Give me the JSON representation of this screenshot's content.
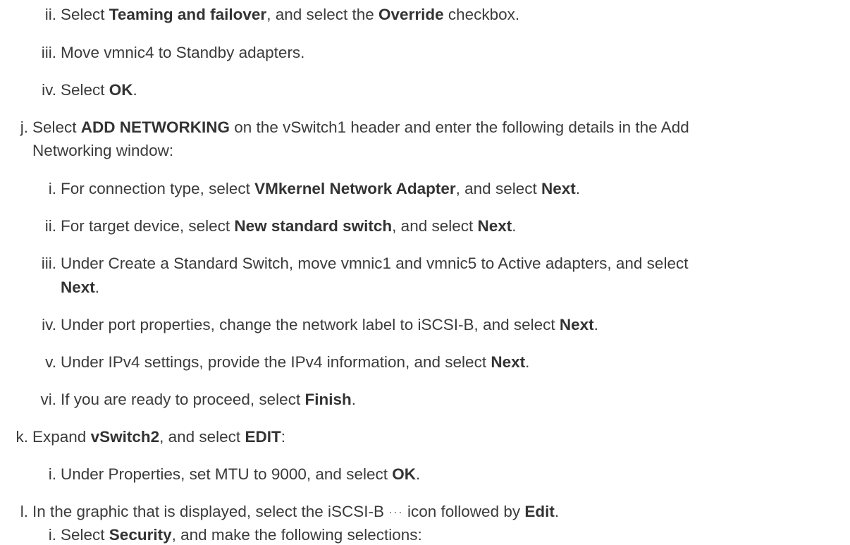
{
  "steps": {
    "ii1": {
      "label": "ii.",
      "a": "Select ",
      "b1": "Teaming and failover",
      "c": ", and select the ",
      "b2": "Override",
      "d": " checkbox."
    },
    "iii1": {
      "label": "iii.",
      "a": "Move vmnic4 to Standby adapters."
    },
    "iv1": {
      "label": "iv.",
      "a": "Select ",
      "b1": "OK",
      "c": "."
    },
    "j": {
      "label": "j.",
      "a": "Select ",
      "b1": "ADD NETWORKING",
      "c": " on the vSwitch1 header and enter the following details in the Add",
      "cont": "Networking window:"
    },
    "j_i": {
      "label": "i.",
      "a": "For connection type, select ",
      "b1": "VMkernel Network Adapter",
      "c": ", and select ",
      "b2": "Next",
      "d": "."
    },
    "j_ii": {
      "label": "ii.",
      "a": "For target device, select ",
      "b1": "New standard switch",
      "c": ", and select ",
      "b2": "Next",
      "d": "."
    },
    "j_iii": {
      "label": "iii.",
      "a": "Under Create a Standard Switch, move vmnic1 and vmnic5 to Active adapters, and select",
      "cont_b": "Next",
      "cont_c": "."
    },
    "j_iv": {
      "label": "iv.",
      "a": "Under port properties, change the network label to iSCSI-B, and select ",
      "b1": "Next",
      "c": "."
    },
    "j_v": {
      "label": "v.",
      "a": "Under IPv4 settings, provide the IPv4 information, and select ",
      "b1": "Next",
      "c": "."
    },
    "j_vi": {
      "label": "vi.",
      "a": "If you are ready to proceed, select ",
      "b1": "Finish",
      "c": "."
    },
    "k": {
      "label": "k.",
      "a": "Expand ",
      "b1": "vSwitch2",
      "c": ", and select ",
      "b2": "EDIT",
      "d": ":"
    },
    "k_i": {
      "label": "i.",
      "a": "Under Properties, set MTU to 9000, and select ",
      "b1": "OK",
      "c": "."
    },
    "l": {
      "label": "l.",
      "a": "In the graphic that is displayed, select the iSCSI-B",
      "icon": "···",
      "c": "icon followed by ",
      "b1": "Edit",
      "d": "."
    },
    "l_i": {
      "label": "i.",
      "a": "Select ",
      "b1": "Security",
      "c": ", and make the following selections:"
    }
  }
}
